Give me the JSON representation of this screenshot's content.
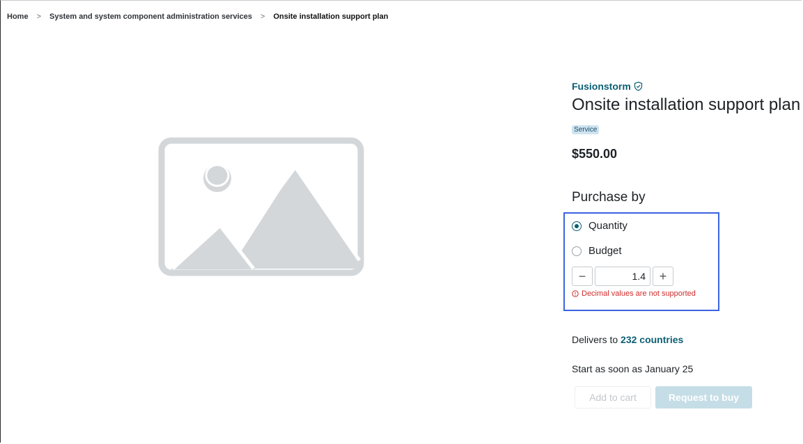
{
  "breadcrumb": {
    "home": "Home",
    "category": "System and system component administration services",
    "current": "Onsite installation support plan",
    "separator": ">"
  },
  "product": {
    "vendor": "Fusionstorm",
    "vendor_icon": "shield-check-icon",
    "title": "Onsite installation support plan",
    "badge": "Service",
    "price": "$550.00",
    "image_icon": "image-placeholder-icon"
  },
  "purchase": {
    "heading": "Purchase by",
    "options": [
      {
        "label": "Quantity",
        "selected": true
      },
      {
        "label": "Budget",
        "selected": false
      }
    ],
    "quantity_value": "1.4",
    "decrement_label": "−",
    "increment_label": "+",
    "error_message": "Decimal values are not supported",
    "error_icon": "alert-circle-icon"
  },
  "delivery": {
    "prefix": "Delivers to",
    "countries_link": "232 countries",
    "start_text": "Start as soon as January 25"
  },
  "actions": {
    "add_to_cart": "Add to cart",
    "request_to_buy": "Request to buy"
  },
  "colors": {
    "accent": "#0b5f73",
    "error": "#d02b2b",
    "highlight": "#3a63e0",
    "badge_bg": "#cfe3f0"
  }
}
